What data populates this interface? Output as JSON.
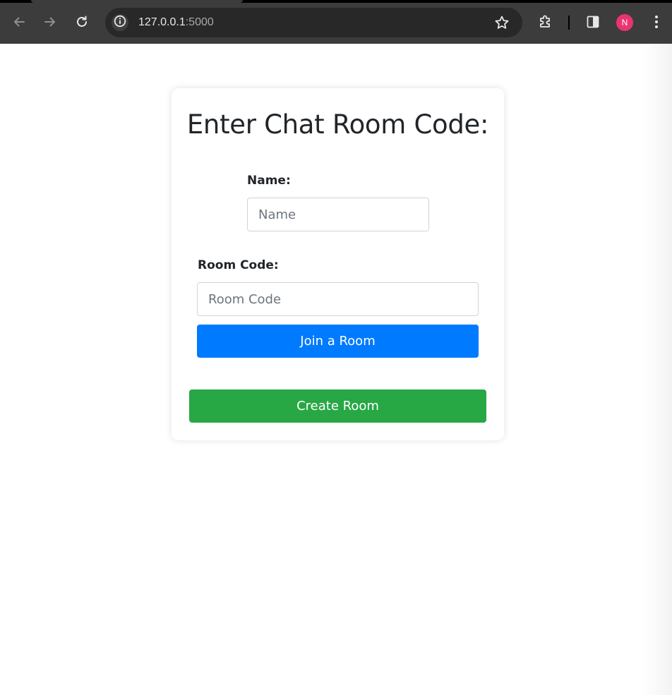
{
  "browser": {
    "url_host": "127.0.0.1",
    "url_port": ":5000",
    "profile_initial": "N",
    "icons": {
      "back": "arrow-left-icon",
      "forward": "arrow-right-icon",
      "reload": "reload-icon",
      "site_info": "info-icon",
      "bookmark": "star-icon",
      "extensions": "puzzle-icon",
      "side_panel": "side-panel-icon",
      "menu": "kebab-menu-icon"
    },
    "colors": {
      "toolbar": "#3c3c3c",
      "omnibox": "#282828",
      "avatar": "#e8346f"
    }
  },
  "page": {
    "title": "Enter Chat Room Code:",
    "name_label": "Name:",
    "name_placeholder": "Name",
    "room_code_label": "Room Code:",
    "room_code_placeholder": "Room Code",
    "join_button": "Join a Room",
    "create_button": "Create Room",
    "colors": {
      "join": "#007bff",
      "create": "#28a745",
      "text": "#212529"
    }
  }
}
